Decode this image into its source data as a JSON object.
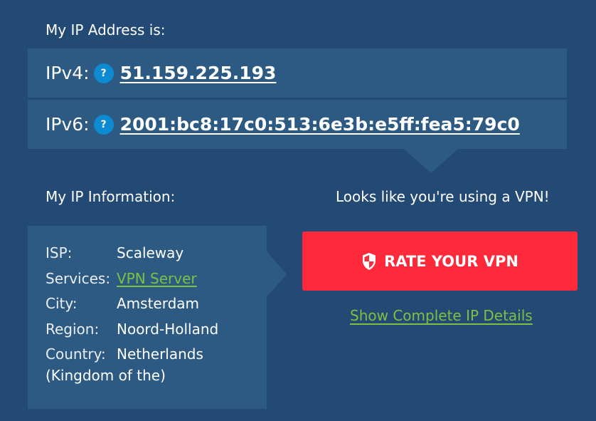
{
  "ip_section": {
    "heading": "My IP Address is:",
    "ipv4": {
      "label": "IPv4:",
      "help": "?",
      "value": "51.159.225.193"
    },
    "ipv6": {
      "label": "IPv6:",
      "help": "?",
      "value": "2001:bc8:17c0:513:6e3b:e5ff:fea5:79c0"
    }
  },
  "info_section": {
    "heading": "My IP Information:",
    "rows": [
      {
        "label": "ISP:",
        "value": "Scaleway"
      },
      {
        "label": "Services:",
        "value": "VPN Server"
      },
      {
        "label": "City:",
        "value": "Amsterdam"
      },
      {
        "label": "Region:",
        "value": "Noord-Holland"
      },
      {
        "label": "Country:",
        "value": "Netherlands"
      }
    ],
    "country_continuation": "(Kingdom of the)"
  },
  "vpn_section": {
    "message": "Looks like you're using a VPN!",
    "button_label": "RATE YOUR VPN",
    "button_icon": "shield-icon",
    "details_link": "Show Complete IP Details"
  },
  "colors": {
    "background": "#234a74",
    "panel": "#2c5a83",
    "accent_blue": "#0c8ad2",
    "button_red": "#fe2a3c",
    "link_green": "#7dc143"
  }
}
